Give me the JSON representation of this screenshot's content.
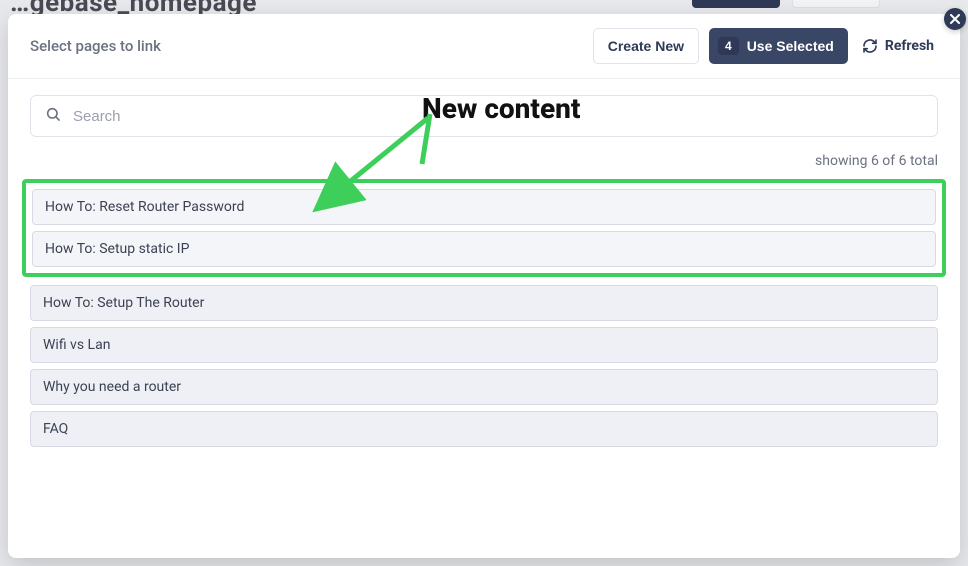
{
  "header": {
    "title": "Select pages to link",
    "create_label": "Create New",
    "use_selected_label": "Use Selected",
    "selected_count": "4",
    "refresh_label": "Refresh"
  },
  "search": {
    "placeholder": "Search",
    "value": ""
  },
  "count_text": "showing 6 of 6 total",
  "annotation_label": "New content",
  "highlighted_rows": [
    {
      "label": "How To: Reset Router Password"
    },
    {
      "label": "How To: Setup static IP"
    }
  ],
  "rows": [
    {
      "label": "How To: Setup The Router"
    },
    {
      "label": "Wifi vs Lan"
    },
    {
      "label": "Why you need a router"
    },
    {
      "label": "FAQ"
    }
  ],
  "bg": {
    "partial_title": "…gebase_homepage"
  }
}
